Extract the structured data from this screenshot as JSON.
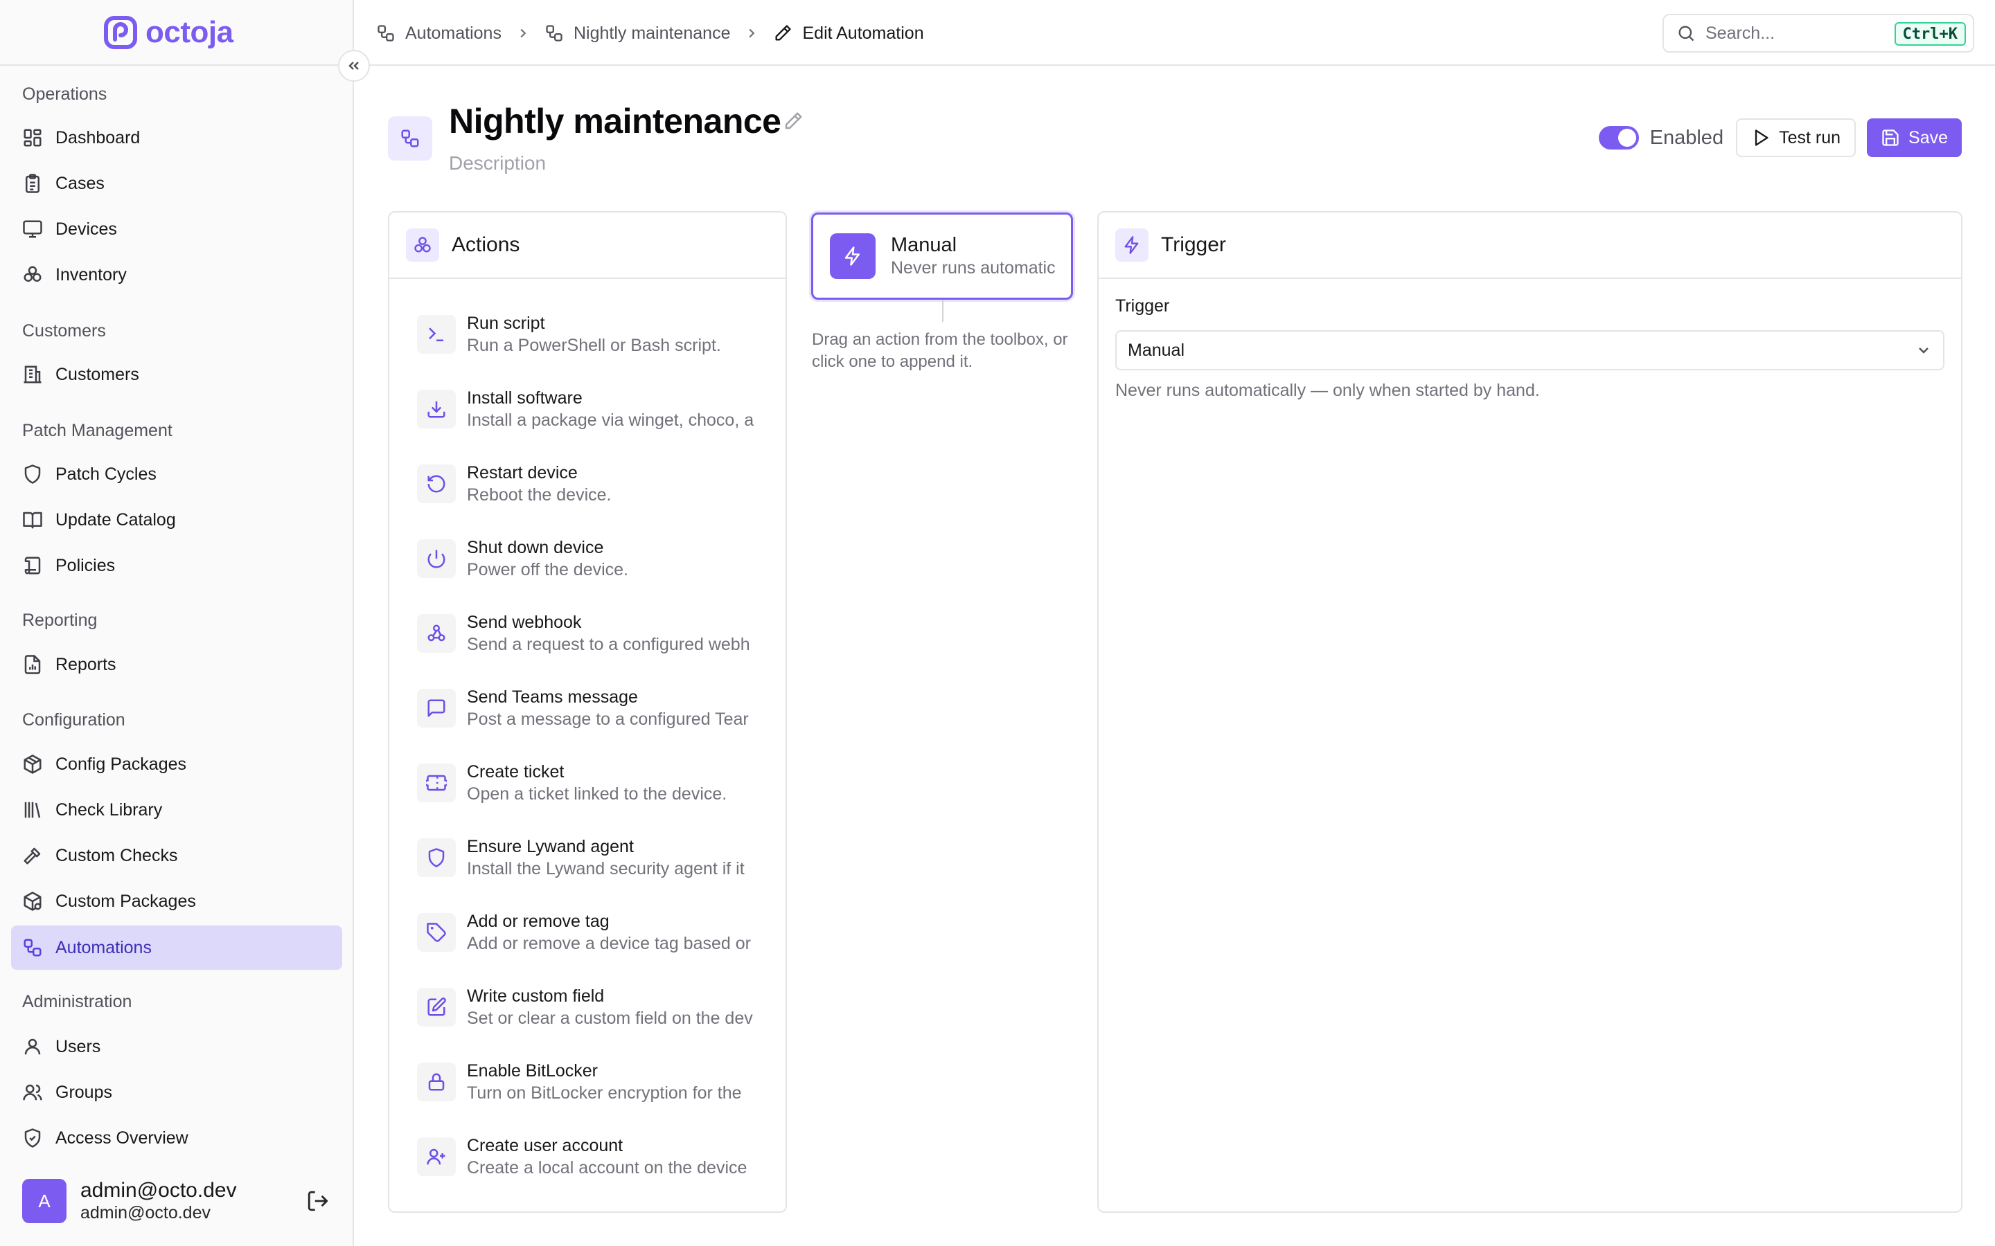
{
  "brand": {
    "name": "octoja",
    "accent": "#7c5cf0"
  },
  "sidebar": {
    "sections": [
      {
        "label": "Operations"
      },
      {
        "label": "Customers"
      },
      {
        "label": "Patch Management"
      },
      {
        "label": "Reporting"
      },
      {
        "label": "Configuration"
      },
      {
        "label": "Administration"
      }
    ],
    "items": [
      {
        "label": "Dashboard",
        "icon": "dashboard-icon"
      },
      {
        "label": "Cases",
        "icon": "clipboard-icon"
      },
      {
        "label": "Devices",
        "icon": "monitor-icon"
      },
      {
        "label": "Inventory",
        "icon": "boxes-icon"
      },
      {
        "label": "Customers",
        "icon": "building-icon"
      },
      {
        "label": "Patch Cycles",
        "icon": "shield-icon"
      },
      {
        "label": "Update Catalog",
        "icon": "book-icon"
      },
      {
        "label": "Policies",
        "icon": "scroll-icon"
      },
      {
        "label": "Reports",
        "icon": "report-icon"
      },
      {
        "label": "Config Packages",
        "icon": "package-icon"
      },
      {
        "label": "Check Library",
        "icon": "library-icon"
      },
      {
        "label": "Custom Checks",
        "icon": "hammer-icon"
      },
      {
        "label": "Custom Packages",
        "icon": "packages-icon"
      },
      {
        "label": "Automations",
        "icon": "workflow-icon",
        "active": true
      },
      {
        "label": "Users",
        "icon": "user-icon"
      },
      {
        "label": "Groups",
        "icon": "users-icon"
      },
      {
        "label": "Access Overview",
        "icon": "shield-check-icon"
      }
    ],
    "user": {
      "initial": "A",
      "name": "admin@octo.dev",
      "email": "admin@octo.dev"
    }
  },
  "breadcrumb": [
    {
      "label": "Automations",
      "icon": "workflow-icon"
    },
    {
      "label": "Nightly maintenance",
      "icon": "workflow-icon"
    },
    {
      "label": "Edit Automation",
      "icon": "pencil-icon"
    }
  ],
  "search": {
    "placeholder": "Search...",
    "shortcut": "Ctrl+K"
  },
  "header": {
    "title": "Nightly maintenance",
    "description_placeholder": "Description",
    "enabled": true,
    "enabled_label": "Enabled",
    "test_run_label": "Test run",
    "save_label": "Save"
  },
  "actions_panel": {
    "title": "Actions",
    "items": [
      {
        "title": "Run script",
        "desc": "Run a PowerShell or Bash script.",
        "icon": "terminal-icon"
      },
      {
        "title": "Install software",
        "desc": "Install a package via winget, choco, a",
        "icon": "download-icon"
      },
      {
        "title": "Restart device",
        "desc": "Reboot the device.",
        "icon": "restart-icon"
      },
      {
        "title": "Shut down device",
        "desc": "Power off the device.",
        "icon": "power-icon"
      },
      {
        "title": "Send webhook",
        "desc": "Send a request to a configured webh",
        "icon": "webhook-icon"
      },
      {
        "title": "Send Teams message",
        "desc": "Post a message to a configured Tear",
        "icon": "message-icon"
      },
      {
        "title": "Create ticket",
        "desc": "Open a ticket linked to the device.",
        "icon": "ticket-icon"
      },
      {
        "title": "Ensure Lywand agent",
        "desc": "Install the Lywand security agent if it",
        "icon": "shield-icon"
      },
      {
        "title": "Add or remove tag",
        "desc": "Add or remove a device tag based or",
        "icon": "tag-icon"
      },
      {
        "title": "Write custom field",
        "desc": "Set or clear a custom field on the dev",
        "icon": "edit-icon"
      },
      {
        "title": "Enable BitLocker",
        "desc": "Turn on BitLocker encryption for the",
        "icon": "lock-icon"
      },
      {
        "title": "Create user account",
        "desc": "Create a local account on the device",
        "icon": "user-plus-icon"
      }
    ]
  },
  "canvas": {
    "trigger_node": {
      "title": "Manual",
      "desc": "Never runs automatic"
    },
    "hint": "Drag an action from the toolbox, or click one to append it."
  },
  "trigger_panel": {
    "title": "Trigger",
    "field_label": "Trigger",
    "selected": "Manual",
    "help": "Never runs automatically — only when started by hand."
  }
}
